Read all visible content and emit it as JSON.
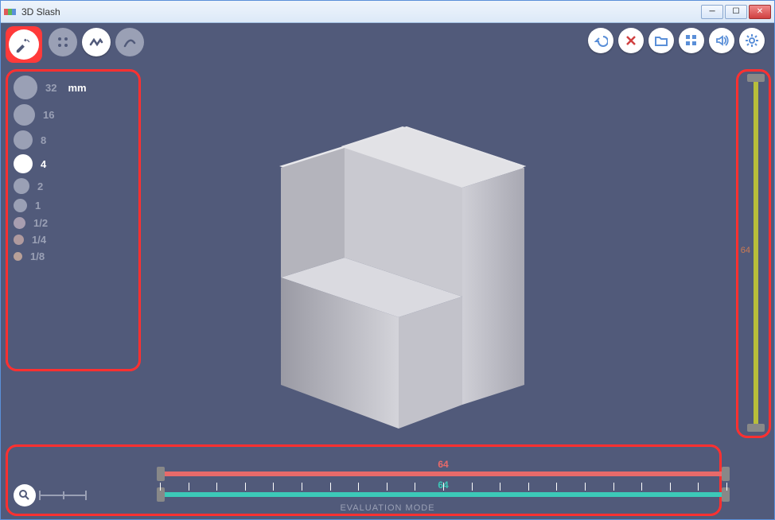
{
  "window": {
    "title": "3D Slash"
  },
  "sizes": {
    "unit": "mm",
    "items": [
      {
        "label": "32",
        "d": 30
      },
      {
        "label": "16",
        "d": 27
      },
      {
        "label": "8",
        "d": 24
      },
      {
        "label": "4",
        "d": 24,
        "selected": true
      },
      {
        "label": "2",
        "d": 20
      },
      {
        "label": "1",
        "d": 17
      },
      {
        "label": "1/2",
        "d": 15
      },
      {
        "label": "1/4",
        "d": 13
      },
      {
        "label": "1/8",
        "d": 11
      }
    ]
  },
  "sliders": {
    "vertical": {
      "value": "64"
    },
    "red": {
      "value": "64"
    },
    "teal": {
      "value": "64"
    }
  },
  "footer": {
    "mode": "EVALUATION MODE"
  }
}
